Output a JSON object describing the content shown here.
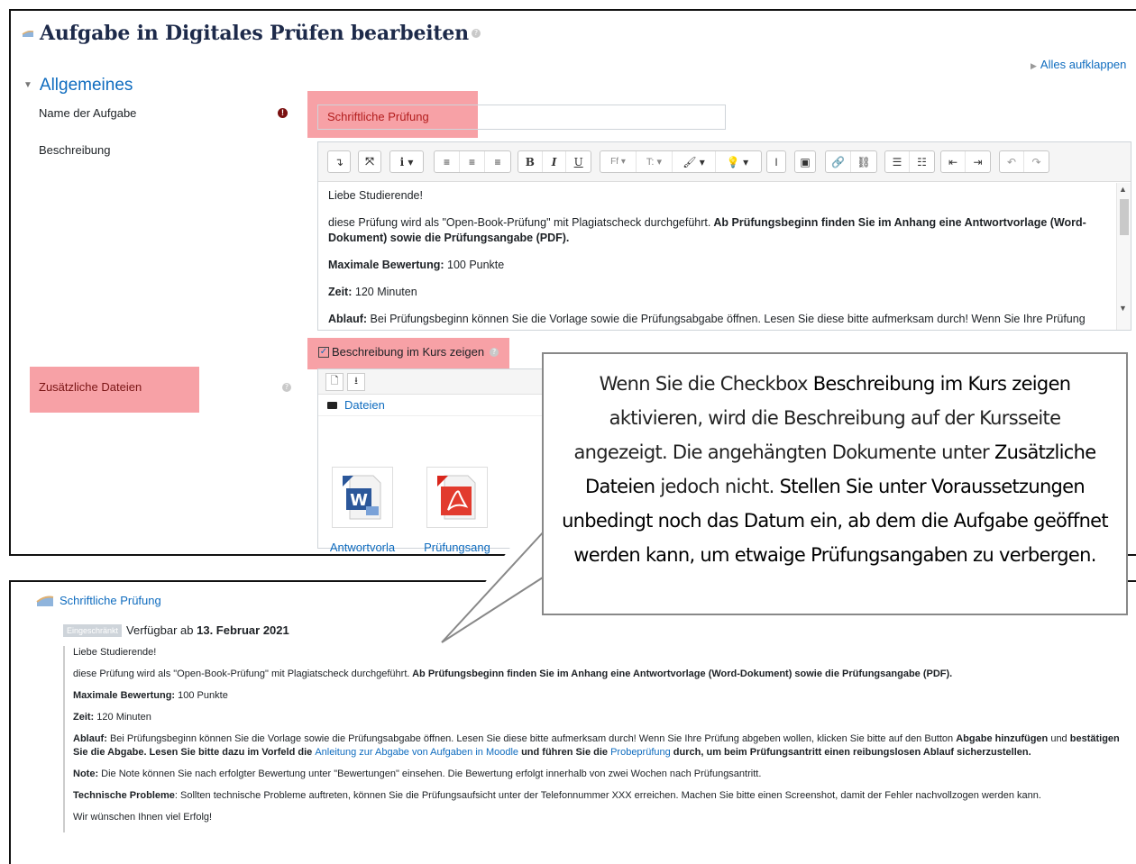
{
  "edit": {
    "title": "Aufgabe in Digitales Prüfen bearbeiten",
    "expand_all": "Alles aufklappen",
    "section": "Allgemeines",
    "name_label": "Name der Aufgabe",
    "name_value": "Schriftliche Prüfung",
    "description_label": "Beschreibung",
    "description": {
      "greeting": "Liebe Studierende!",
      "p1_plain": "diese Prüfung wird als \"Open-Book-Prüfung\" mit Plagiatscheck durchgeführt.",
      "p1_bold": " Ab Prüfungsbeginn finden Sie im Anhang eine Antwortvorlage (Word-Dokument) sowie die Prüfungsangabe (PDF).",
      "max_label": "Maximale Bewertung:",
      "max_value": " 100 Punkte",
      "time_label": "Zeit:",
      "time_value": " 120 Minuten",
      "flow_label": "Ablauf:",
      "flow_value": " Bei Prüfungsbeginn können Sie die Vorlage sowie die Prüfungsabgabe öffnen. Lesen Sie diese bitte aufmerksam durch! Wenn Sie Ihre Prüfung"
    },
    "show_in_course_label": "Beschreibung im Kurs zeigen",
    "files_label": "Zusätzliche Dateien",
    "files_folder": "Dateien",
    "files": [
      "Antwortvorla",
      "Prüfungsang"
    ]
  },
  "course": {
    "activity": "Schriftliche Prüfung",
    "restricted_badge": "Eingeschränkt",
    "available_from_prefix": "Verfügbar ab ",
    "available_from_date": "13. Februar 2021",
    "greeting": "Liebe Studierende!",
    "p1_plain": "diese Prüfung wird als \"Open-Book-Prüfung\" mit Plagiatscheck durchgeführt.",
    "p1_bold": " Ab Prüfungsbeginn finden Sie im Anhang eine Antwortvorlage (Word-Dokument) sowie die Prüfungsangabe (PDF).",
    "max_label": "Maximale Bewertung:",
    "max_value": " 100 Punkte",
    "time_label": "Zeit:",
    "time_value": " 120 Minuten",
    "flow_label": "Ablauf:",
    "flow_1": " Bei Prüfungsbeginn können Sie die Vorlage sowie die Prüfungsabgabe öffnen. Lesen Sie diese bitte aufmerksam durch! Wenn Sie Ihre Prüfung abgeben wollen, klicken Sie bitte auf den Button ",
    "flow_b1": "Abgabe hinzufügen",
    "flow_2": " und ",
    "flow_b2": "bestätigen Sie die Abgabe. Lesen Sie bitte dazu im Vorfeld die ",
    "flow_link1": "Anleitung zur Abgabe von Aufgaben in Moodle",
    "flow_b3": " und führen Sie die ",
    "flow_link2": "Probeprüfung",
    "flow_b4": " durch, um beim Prüfungsantritt einen reibungslosen Ablauf sicherzustellen.",
    "note_label": "Note:",
    "note_value": " Die Note können Sie nach erfolgter Bewertung unter \"Bewertungen\" einsehen. Die Bewertung erfolgt innerhalb von zwei Wochen nach Prüfungsantritt.",
    "tech_label": "Technische Probleme",
    "tech_value": ": Sollten technische Probleme auftreten, können Sie die Prüfungsaufsicht unter der Telefonnummer XXX erreichen. Machen Sie bitte einen Screenshot, damit der Fehler nachvollzogen werden kann.",
    "closing": "Wir wünschen Ihnen viel Erfolg!"
  },
  "callout": {
    "t1": "Wenn Sie die Checkbox ",
    "b1": "Beschreibung im Kurs zeigen",
    "t2": " aktivieren, wird die Beschreibung auf der Kursseite angezeigt. Die angehängten Dokumente unter ",
    "b2": "Zusätzliche Dateien",
    "t3": " jedoch nicht. ",
    "b3": "Stellen Sie unter Voraussetzungen unbedingt noch das Datum ein, ab dem die Aufgabe geöffnet werden kann, um etwaige Prüfungsangaben zu verbergen."
  },
  "colors": {
    "link": "#0f6cbf",
    "highlight": "#f7a1a6",
    "required": "#7a0f0f"
  },
  "icons": [
    "assignment-icon",
    "required-icon",
    "help-icon",
    "folder-icon",
    "word-file-icon",
    "pdf-file-icon"
  ]
}
